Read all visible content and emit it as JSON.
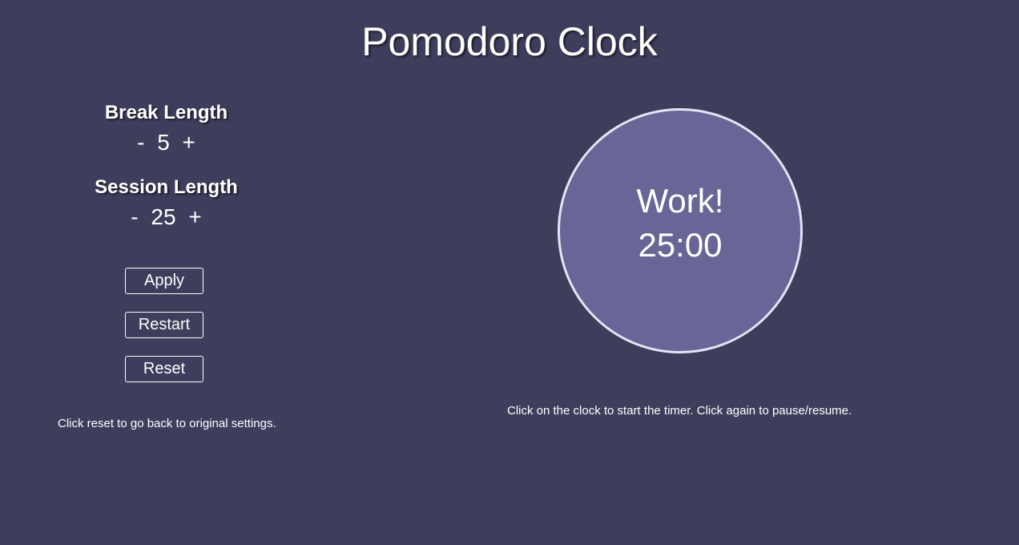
{
  "app": {
    "title": "Pomodoro Clock"
  },
  "break": {
    "heading": "Break Length",
    "decrement": "-",
    "value": "5",
    "increment": "+"
  },
  "session": {
    "heading": "Session Length",
    "decrement": "-",
    "value": "25",
    "increment": "+"
  },
  "buttons": {
    "apply": "Apply",
    "restart": "Restart",
    "reset": "Reset"
  },
  "hints": {
    "reset": "Click reset to go back to original settings.",
    "clock": "Click on the clock to start the timer. Click again to pause/resume."
  },
  "clock": {
    "label": "Work!",
    "time": "25:00"
  },
  "colors": {
    "background": "#3e3d5b",
    "clock_fill": "#676696",
    "clock_border": "#e6e4f5",
    "text": "#ffffff"
  }
}
